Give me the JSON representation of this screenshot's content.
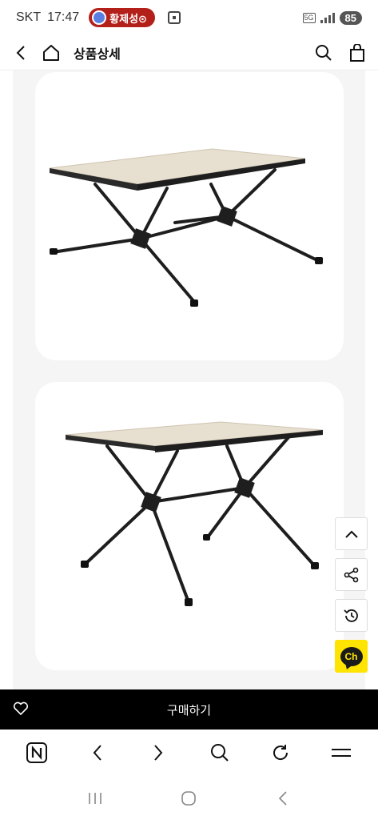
{
  "status_bar": {
    "carrier": "SKT",
    "time": "17:47",
    "call_name": "황제성⊙",
    "network": "5G",
    "battery": "85"
  },
  "header": {
    "title": "상품상세",
    "icons": [
      "back-icon",
      "home-icon",
      "search-icon",
      "shopping-bag-icon"
    ]
  },
  "floating_buttons": [
    "scroll-top-icon",
    "share-icon",
    "history-icon",
    "kakao-channel-icon"
  ],
  "kakao_channel_label": "Ch",
  "buy_bar": {
    "label": "구매하기",
    "icon": "heart-icon"
  },
  "browser_bar": {
    "icons": [
      "naver-icon",
      "back-icon",
      "forward-icon",
      "search-icon",
      "refresh-icon",
      "menu-icon"
    ]
  },
  "system_nav": {
    "icons": [
      "recents-icon",
      "home-icon",
      "back-icon"
    ]
  },
  "colors": {
    "call_pill": "#b3201a",
    "kakao": "#ffe400",
    "buy_bar": "#000000",
    "table_top": "#e6dccb",
    "frame": "#1e1e1e"
  }
}
